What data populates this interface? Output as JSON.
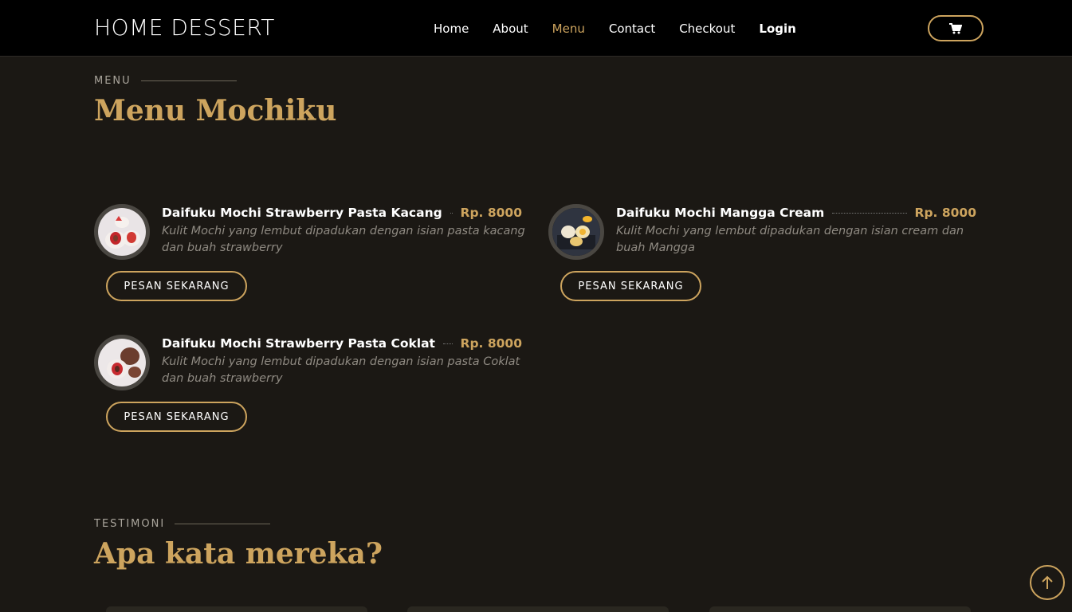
{
  "header": {
    "brand": "HOME DESSERT",
    "nav": [
      {
        "label": "Home",
        "active": false,
        "bold": false
      },
      {
        "label": "About",
        "active": false,
        "bold": false
      },
      {
        "label": "Menu",
        "active": true,
        "bold": false
      },
      {
        "label": "Contact",
        "active": false,
        "bold": false
      },
      {
        "label": "Checkout",
        "active": false,
        "bold": false
      },
      {
        "label": "Login",
        "active": false,
        "bold": true
      }
    ],
    "cart_icon": "cart-icon"
  },
  "menu_section": {
    "tag": "MENU",
    "title": "Menu Mochiku",
    "items": [
      {
        "name": "Daifuku Mochi Strawberry Pasta Kacang",
        "price": "Rp. 8000",
        "description": "Kulit Mochi yang lembut dipadukan dengan isian pasta kacang dan buah strawberry",
        "button": "PESAN SEKARANG"
      },
      {
        "name": "Daifuku Mochi Mangga Cream",
        "price": "Rp. 8000",
        "description": "Kulit Mochi yang lembut dipadukan dengan isian cream dan buah Mangga",
        "button": "PESAN SEKARANG"
      },
      {
        "name": "Daifuku Mochi Strawberry Pasta Coklat",
        "price": "Rp. 8000",
        "description": "Kulit Mochi yang lembut dipadukan dengan isian pasta Coklat dan buah strawberry",
        "button": "PESAN SEKARANG"
      }
    ]
  },
  "testimonial_section": {
    "tag": "TESTIMONI",
    "title": "Apa kata mereka?"
  },
  "colors": {
    "accent": "#cda45e",
    "background": "#1b1814",
    "navbar": "#000000"
  },
  "scroll_top_icon": "arrow-up-icon"
}
